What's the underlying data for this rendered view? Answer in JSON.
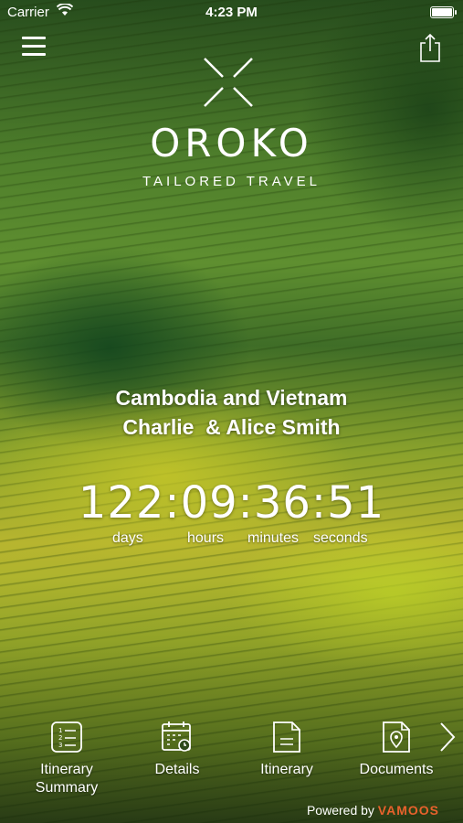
{
  "status_bar": {
    "carrier": "Carrier",
    "time": "4:23 PM"
  },
  "header": {
    "menu_icon": "hamburger-icon",
    "share_icon": "share-icon"
  },
  "brand": {
    "name": "OROKO",
    "tagline": "TAILORED TRAVEL",
    "logo_icon": "x-mark-logo"
  },
  "trip": {
    "title": "Cambodia and Vietnam",
    "travellers": "Charlie  & Alice Smith"
  },
  "countdown": {
    "display": "122:09:36:51",
    "labels": {
      "days": "days",
      "hours": "hours",
      "minutes": "minutes",
      "seconds": "seconds"
    }
  },
  "nav": {
    "items": [
      {
        "label": "Itinerary\nSummary",
        "icon": "numbered-list-icon"
      },
      {
        "label": "Details",
        "icon": "calendar-clock-icon"
      },
      {
        "label": "Itinerary",
        "icon": "document-icon"
      },
      {
        "label": "Documents",
        "icon": "location-document-icon"
      }
    ],
    "next_icon": "chevron-right-icon"
  },
  "footer": {
    "powered_prefix": "Powered by",
    "powered_brand": "VAMOOS",
    "brand_color": "#e8612c"
  }
}
